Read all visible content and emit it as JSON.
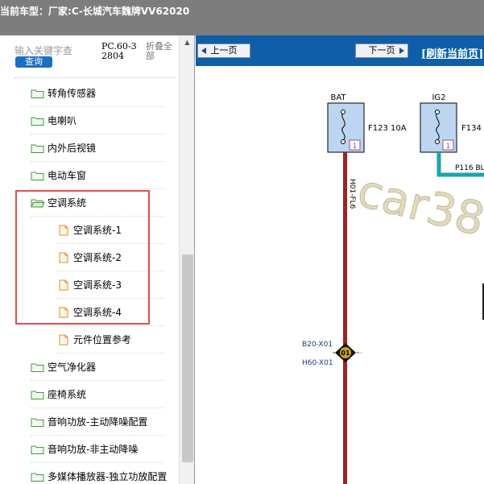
{
  "title_bar": {
    "model_prefix": "当前车型：",
    "manufacturer_text": "厂家:C-长城汽车魏牌VV62020"
  },
  "sidebar": {
    "search_placeholder": "输入关键字查",
    "search_button": "查询",
    "pc_label": "PC.60-32804",
    "fold_all": "折叠全部",
    "items": [
      {
        "label": "转角传感器",
        "type": "folder",
        "level": 1
      },
      {
        "label": "电喇叭",
        "type": "folder",
        "level": 1
      },
      {
        "label": "内外后视镜",
        "type": "folder",
        "level": 1
      },
      {
        "label": "电动车窗",
        "type": "folder",
        "level": 1
      },
      {
        "label": "空调系统",
        "type": "folder-open",
        "level": 1
      },
      {
        "label": "空调系统-1",
        "type": "file",
        "level": 2
      },
      {
        "label": "空调系统-2",
        "type": "file",
        "level": 2
      },
      {
        "label": "空调系统-3",
        "type": "file",
        "level": 2
      },
      {
        "label": "空调系统-4",
        "type": "file",
        "level": 2
      },
      {
        "label": "元件位置参考",
        "type": "file",
        "level": 2
      },
      {
        "label": "空气净化器",
        "type": "folder",
        "level": 1
      },
      {
        "label": "座椅系统",
        "type": "folder",
        "level": 1
      },
      {
        "label": "音响功放-主动降噪配置",
        "type": "folder",
        "level": 1
      },
      {
        "label": "音响功放-非主动降噪",
        "type": "folder",
        "level": 1
      },
      {
        "label": "多媒体播放器-独立功放配置",
        "type": "folder",
        "level": 1
      }
    ]
  },
  "toolbar": {
    "prev_label": "上一页",
    "next_label": "下一页",
    "refresh_label": "[刷新当前页]"
  },
  "diagram": {
    "fuse1": {
      "label": "BAT",
      "name": "F123 10A",
      "pin": "1"
    },
    "fuse2": {
      "label": "IG2",
      "name": "F134",
      "pin": "1"
    },
    "wire_vertical": "H01-FL6",
    "wire_horizontal": "P116 BL",
    "splice": "01",
    "connector_b20": "B20-X01",
    "connector_h60": "H60-X01",
    "watermark": "car38"
  },
  "colors": {
    "title_bg": "#7d7d7d",
    "nav_bg": "#0e5fa8",
    "highlight": "#d9534f",
    "wire_red": "#a4231e",
    "wire_cyan": "#1aa7a9",
    "fuse_fill": "#bcd6f1",
    "folder_green": "#3d9c3d",
    "file_orange": "#e58b25"
  }
}
